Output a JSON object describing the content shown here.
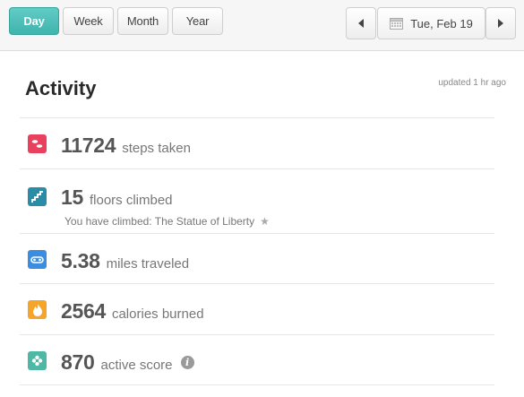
{
  "range_tabs": [
    {
      "label": "Day",
      "active": true
    },
    {
      "label": "Week",
      "active": false
    },
    {
      "label": "Month",
      "active": false
    },
    {
      "label": "Year",
      "active": false
    }
  ],
  "date_nav": {
    "prev_icon": "chevron-left-icon",
    "next_icon": "chevron-right-icon",
    "calendar_icon": "calendar-icon",
    "date_label": "Tue, Feb 19"
  },
  "activity": {
    "title": "Activity",
    "updated": "updated 1 hr ago",
    "stats": [
      {
        "icon": "steps-icon",
        "color": "#e8405d",
        "value": "11724",
        "label": "steps taken"
      },
      {
        "icon": "stairs-icon",
        "color": "#2a8ca6",
        "value": "15",
        "label": "floors climbed",
        "note": "You have climbed: The Statue of Liberty",
        "note_icon": "star-icon"
      },
      {
        "icon": "distance-icon",
        "color": "#3a8de0",
        "value": "5.38",
        "label": "miles traveled"
      },
      {
        "icon": "flame-icon",
        "color": "#f5a52a",
        "value": "2564",
        "label": "calories burned"
      },
      {
        "icon": "flower-icon",
        "color": "#4db8a3",
        "value": "870",
        "label": "active score",
        "info_icon": "info-icon"
      }
    ]
  },
  "colors": {
    "accent": "#4cbfb9",
    "background": "#ffffff",
    "topbar": "#f6f6f6"
  }
}
